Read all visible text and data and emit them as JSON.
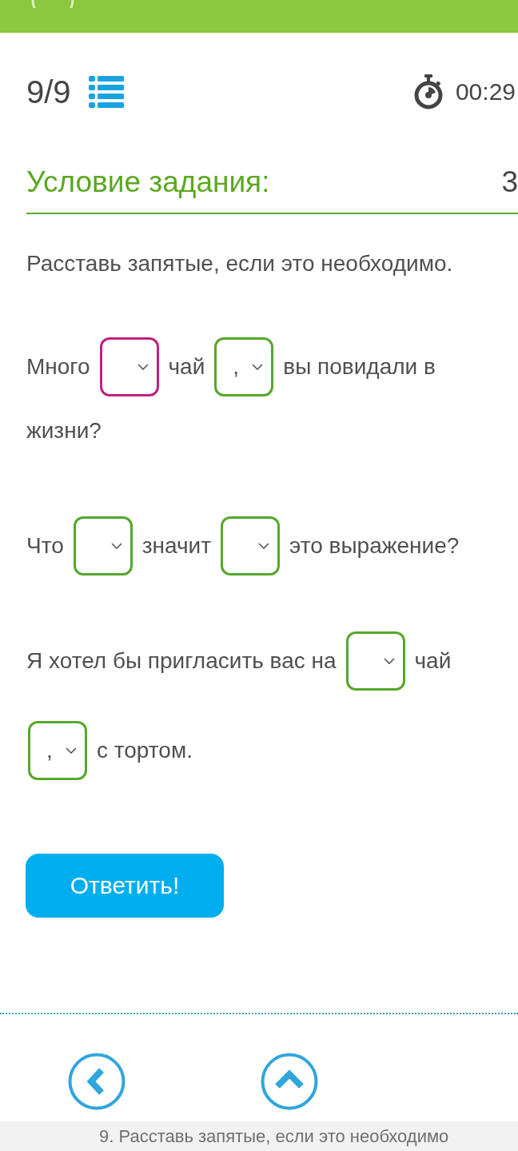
{
  "progress": {
    "counter": "9/9",
    "timer": "00:29"
  },
  "task": {
    "title": "Условие задания:",
    "right_text": "3",
    "instruction": "Расставь запятые, если это необходимо."
  },
  "sentences": [
    {
      "lines": [
        {
          "parts": [
            {
              "kind": "text",
              "text": "Много"
            },
            {
              "kind": "select",
              "highlighted": true
            },
            {
              "kind": "text",
              "text": "чай"
            },
            {
              "kind": "select",
              "value": ",",
              "highlighted": false
            },
            {
              "kind": "text",
              "text": "вы повидали в"
            }
          ]
        },
        {
          "parts": [
            {
              "kind": "text",
              "text": "жизни?"
            }
          ]
        }
      ]
    },
    {
      "lines": [
        {
          "parts": [
            {
              "kind": "text",
              "text": "Что"
            },
            {
              "kind": "select",
              "highlighted": false
            },
            {
              "kind": "text",
              "text": "значит"
            },
            {
              "kind": "select",
              "highlighted": false
            },
            {
              "kind": "text",
              "text": "это выражение?"
            }
          ]
        }
      ]
    },
    {
      "lines": [
        {
          "parts": [
            {
              "kind": "text",
              "text": "Я хотел бы пригласить вас на"
            },
            {
              "kind": "select",
              "highlighted": false
            },
            {
              "kind": "text",
              "text": "чай"
            }
          ]
        },
        {
          "parts": [
            {
              "kind": "select",
              "value": ",",
              "highlighted": false
            },
            {
              "kind": "text",
              "text": "с тортом."
            }
          ]
        }
      ]
    }
  ],
  "submit_button": {
    "label": "Ответить!"
  },
  "footer": {
    "caption": "9. Расставь запятые, если это необходимо"
  }
}
